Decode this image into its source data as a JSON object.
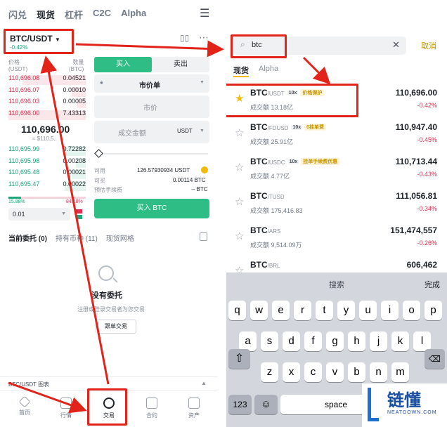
{
  "left": {
    "nav": [
      "闪兑",
      "现货",
      "杠杆",
      "C2C",
      "Alpha"
    ],
    "menu_icon": "hamburger-menu-icon",
    "pair": "BTC/USDT",
    "pair_change": "-0.42%",
    "toolbar_icons": [
      "chart-icon",
      "more-icon"
    ],
    "ob_header": {
      "price_label": "价格",
      "price_unit": "(USDT)",
      "qty_label": "数量",
      "qty_unit": "(BTC)"
    },
    "asks": [
      {
        "p": "110,696.08",
        "q": "0.04521"
      },
      {
        "p": "110,696.07",
        "q": "0.00010"
      },
      {
        "p": "110,696.03",
        "q": "0.00005"
      },
      {
        "p": "110,696.00",
        "q": "7.43313"
      }
    ],
    "mid_price": "110,696.00",
    "mid_sub": "≈ $110,5..",
    "bids": [
      {
        "p": "110,695.99",
        "q": "0.72282"
      },
      {
        "p": "110,695.98",
        "q": "0.00208"
      },
      {
        "p": "110,695.48",
        "q": "0.00021"
      },
      {
        "p": "110,695.47",
        "q": "0.00022"
      }
    ],
    "ratio_buy": "15.88%",
    "ratio_sell": "84.18%",
    "depth_value": "0.01",
    "buy_tab": "买入",
    "sell_tab": "卖出",
    "order_type": "市价单",
    "price_field": "市价",
    "amount_field": "成交金额",
    "amount_unit": "USDT",
    "avail_label": "可用",
    "avail_value": "126.57930934 USDT",
    "buyable_label": "可买",
    "buyable_value": "0.00114 BTC",
    "fee_label": "预估手续费",
    "fee_value": "-- BTC",
    "buy_button": "买入 BTC",
    "order_tabs": [
      "当前委托 (0)",
      "持有币种 (11)",
      "现货网格"
    ],
    "empty_title": "没有委托",
    "empty_sub": "注册或登录交易者为您交易",
    "copy_button": "跟单交易",
    "chart_strip": "BTC/USDT 图表",
    "tabbar": [
      "首页",
      "行情",
      "交易",
      "合约",
      "资产"
    ]
  },
  "right": {
    "search_value": "btc",
    "cancel": "取消",
    "tabs": [
      "现货",
      "Alpha"
    ],
    "rows": [
      {
        "base": "BTC",
        "quote": "/USDT",
        "lev": "10x",
        "tag": "价格保护",
        "vol": "成交额 13.18亿",
        "price": "110,696.00",
        "chg": "-0.42%",
        "fav": true
      },
      {
        "base": "BTC",
        "quote": "/FDUSD",
        "lev": "10x",
        "tag": "0挂单费",
        "vol": "成交额 25.91亿",
        "price": "110,947.40",
        "chg": "-0.45%",
        "fav": false
      },
      {
        "base": "BTC",
        "quote": "/USDC",
        "lev": "10x",
        "tag": "挂单手续费优惠",
        "vol": "成交额 4.77亿",
        "price": "110,713.44",
        "chg": "-0.43%",
        "fav": false
      },
      {
        "base": "BTC",
        "quote": "/TUSD",
        "lev": "",
        "tag": "",
        "vol": "成交额 175,416.83",
        "price": "111,056.81",
        "chg": "-0.34%",
        "fav": false
      },
      {
        "base": "BTC",
        "quote": "/ARS",
        "lev": "",
        "tag": "",
        "vol": "成交额 9,514.09万",
        "price": "151,474,557",
        "chg": "-0.26%",
        "fav": false
      },
      {
        "base": "BTC",
        "quote": "/BRL",
        "lev": "",
        "tag": "",
        "vol": "",
        "price": "606,462",
        "chg": "",
        "fav": false
      }
    ],
    "kb_bar_mid": "搜索",
    "kb_bar_done": "完成",
    "kb_row1": [
      "q",
      "w",
      "e",
      "r",
      "t",
      "y",
      "u",
      "i",
      "o",
      "p"
    ],
    "kb_row2": [
      "a",
      "s",
      "d",
      "f",
      "g",
      "h",
      "j",
      "k",
      "l"
    ],
    "kb_row3": [
      "z",
      "x",
      "c",
      "v",
      "b",
      "n",
      "m"
    ],
    "kb_num": "123",
    "kb_space": "space",
    "watermark_cn": "链懂",
    "watermark_en": "NEATDOWN.COM"
  },
  "colors": {
    "red": "#d9304f",
    "green": "#1fa67a",
    "yellow": "#f0b90b",
    "annotation": "#e2231a"
  }
}
